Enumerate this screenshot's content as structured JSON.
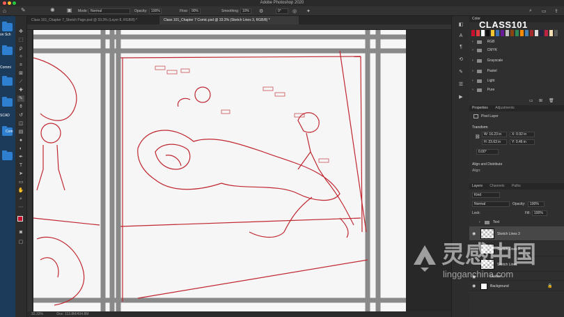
{
  "app": {
    "title": "Adobe Photoshop 2020"
  },
  "options_bar": {
    "mode_label": "Mode:",
    "mode_value": "Normal",
    "opacity_label": "Opacity:",
    "opacity_value": "100%",
    "flow_label": "Flow:",
    "flow_value": "90%",
    "smoothing_label": "Smoothing:",
    "smoothing_value": "10%",
    "angle_value": "0°"
  },
  "tabs": [
    {
      "label": "Class 101_Chapter 7_Sketch Page.psd @ 33.3% (Layer 8, RGB/8) *"
    },
    {
      "label": "Class 101_Chapter 7 Comic.psd @ 33.3% (Sketch Lines 3, RGB/8) *"
    }
  ],
  "desktop": {
    "labels": [
      "on Sch",
      "Commi",
      "SCAD",
      "Com"
    ]
  },
  "status": {
    "zoom": "33.33%",
    "doc": "Doc: 113.8M/434.8M"
  },
  "brand": {
    "logo": "CLASS101"
  },
  "color_panel": {
    "title": "Color",
    "swatches": [
      "#c8102e",
      "#e03a3e",
      "#ffffff",
      "#111111",
      "#f4c430",
      "#3c6fb4",
      "#6a1b9a",
      "#c0c0c0",
      "#8b4513",
      "#2e8b57",
      "#ff8c00",
      "#4682b4",
      "#a52a2a",
      "#dddddd",
      "#222244",
      "#bb2244",
      "#f5deb3",
      "#555555"
    ],
    "groups": [
      "RGB",
      "CMYK",
      "Grayscale",
      "Pastel",
      "Light",
      "Pure"
    ]
  },
  "properties": {
    "tabs": [
      "Properties",
      "Adjustments"
    ],
    "kind": "Pixel Layer",
    "transform_label": "Transform",
    "w": "W: 16.23 in",
    "x": "X: 0.92 in",
    "h": "H: 23.63 in",
    "y": "Y: 0.46 in",
    "angle": "0.00°",
    "align_label": "Align and Distribute",
    "align_sub": "Align:"
  },
  "layers": {
    "tabs": [
      "Layers",
      "Channels",
      "Paths"
    ],
    "kind": "Kind",
    "blend": "Normal",
    "opacity_label": "Opacity:",
    "opacity": "100%",
    "lock_label": "Lock:",
    "fill_label": "Fill:",
    "fill": "100%",
    "items": [
      {
        "name": "Text"
      },
      {
        "name": "Sketch Lines 3"
      },
      {
        "name": "Sketch Lines 2"
      },
      {
        "name": "Sketch Lines"
      },
      {
        "name": "Guides"
      },
      {
        "name": "Background"
      }
    ]
  },
  "watermark": {
    "cn": "灵感中国",
    "url": "lingganchina.com"
  }
}
